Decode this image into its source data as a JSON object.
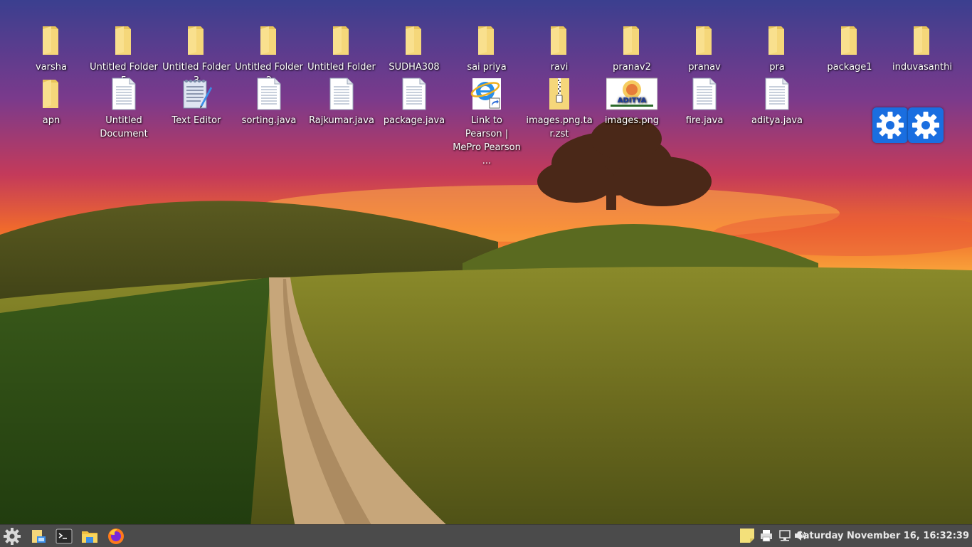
{
  "desktop": {
    "row1": [
      {
        "label": "varsha",
        "icon": "folder-icon"
      },
      {
        "label": "Untitled Folder 5",
        "icon": "folder-icon"
      },
      {
        "label": "Untitled Folder 3",
        "icon": "folder-icon"
      },
      {
        "label": "Untitled Folder 2",
        "icon": "folder-icon"
      },
      {
        "label": "Untitled Folder",
        "icon": "folder-icon"
      },
      {
        "label": "SUDHA308",
        "icon": "folder-icon"
      },
      {
        "label": "sai priya",
        "icon": "folder-icon"
      },
      {
        "label": "ravi",
        "icon": "folder-icon"
      },
      {
        "label": "pranav2",
        "icon": "folder-icon"
      },
      {
        "label": "pranav",
        "icon": "folder-icon"
      },
      {
        "label": "pra",
        "icon": "folder-icon"
      },
      {
        "label": "package1",
        "icon": "folder-icon"
      },
      {
        "label": "induvasanthi",
        "icon": "folder-icon"
      }
    ],
    "row2": [
      {
        "label": "apn",
        "icon": "folder-icon"
      },
      {
        "label": "Untitled Document",
        "icon": "document-icon"
      },
      {
        "label": "Text Editor",
        "icon": "text-editor-icon"
      },
      {
        "label": "sorting.java",
        "icon": "document-icon"
      },
      {
        "label": "Rajkumar.java",
        "icon": "document-icon"
      },
      {
        "label": "package.java",
        "icon": "document-icon"
      },
      {
        "label": "Link to Pearson | MePro Pearson ...",
        "icon": "internet-explorer-link-icon"
      },
      {
        "label": "images.png.tar.zst",
        "icon": "archive-icon"
      },
      {
        "label": "images.png",
        "icon": "image-thumbnail-icon"
      },
      {
        "label": "fire.java",
        "icon": "document-icon"
      },
      {
        "label": "aditya.java",
        "icon": "document-icon"
      }
    ],
    "widgets": [
      {
        "icon": "gear-icon"
      },
      {
        "icon": "gear-icon"
      }
    ],
    "thumbnail_text": "ADITYA"
  },
  "taskbar": {
    "launchers": [
      {
        "name": "menu-button",
        "icon": "gear-menu-icon"
      },
      {
        "name": "show-desktop-button",
        "icon": "desktop-icon"
      },
      {
        "name": "terminal-button",
        "icon": "terminal-icon"
      },
      {
        "name": "file-manager-button",
        "icon": "folder-icon"
      },
      {
        "name": "firefox-button",
        "icon": "firefox-icon"
      }
    ],
    "tray": {
      "notes_icon": "sticky-note-icon",
      "printer_icon": "printer-icon",
      "network_icon": "network-icon",
      "volume_icon": "volume-icon"
    },
    "clock": "Saturday November 16, 16:32:39"
  },
  "colors": {
    "taskbar_bg": "#4b4b4b",
    "folder": "#f5d77a",
    "widget_blue": "#1a6ee0"
  }
}
